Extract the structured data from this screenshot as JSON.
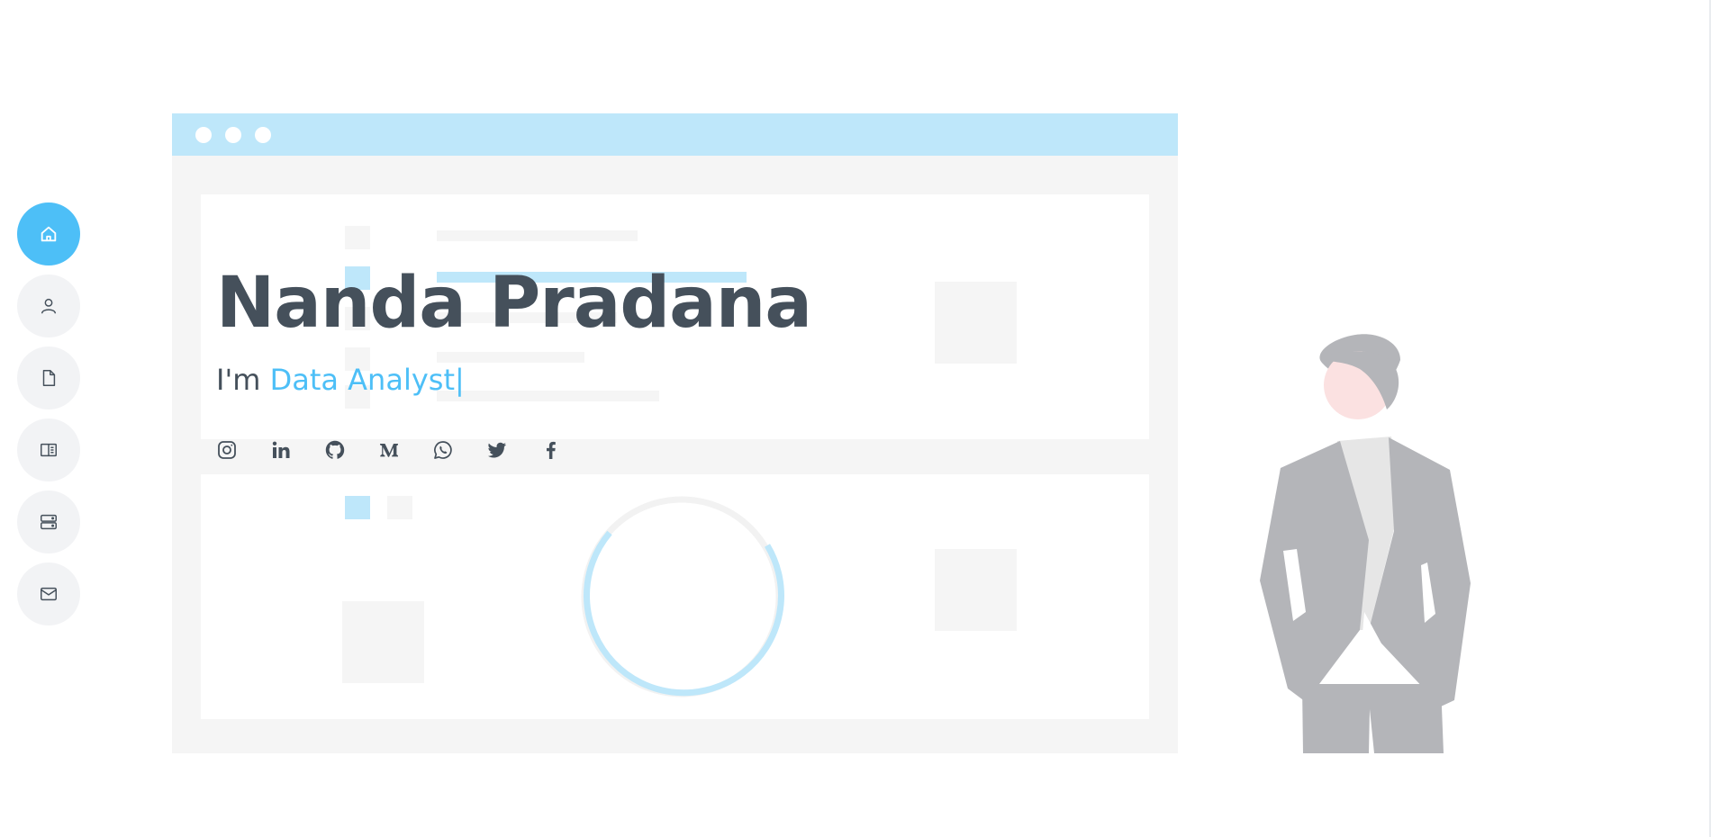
{
  "hero": {
    "name": "Nanda Pradana",
    "prefix": "I'm",
    "typed_text": "Data Analyst",
    "cursor": "|"
  },
  "nav": {
    "items": [
      {
        "icon": "house-icon",
        "active": true
      },
      {
        "icon": "person-icon",
        "active": false
      },
      {
        "icon": "file-icon",
        "active": false
      },
      {
        "icon": "book-icon",
        "active": false
      },
      {
        "icon": "server-icon",
        "active": false
      },
      {
        "icon": "envelope-icon",
        "active": false
      }
    ]
  },
  "social": [
    {
      "icon": "instagram-icon"
    },
    {
      "icon": "linkedin-icon"
    },
    {
      "icon": "github-icon"
    },
    {
      "icon": "medium-icon"
    },
    {
      "icon": "whatsapp-icon"
    },
    {
      "icon": "twitter-icon"
    },
    {
      "icon": "facebook-icon"
    }
  ],
  "colors": {
    "accent": "#4dbff7",
    "text": "#45505b",
    "nav_bg": "#f2f3f5",
    "illustration_bar": "#bee7fa",
    "illustration_panel": "#f5f5f5",
    "person_gray": "#b4b5b9"
  }
}
